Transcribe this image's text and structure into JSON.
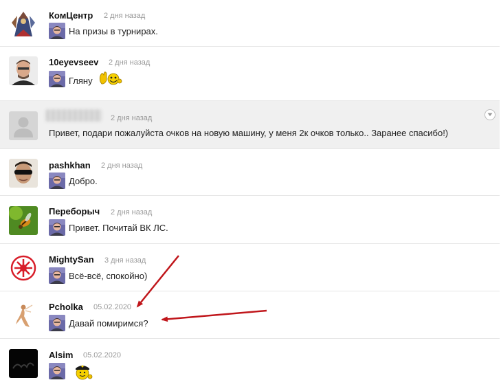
{
  "messages": [
    {
      "name": "КомЦентр",
      "time": "2 дня назад",
      "text": "На призы в турнирах."
    },
    {
      "name": "10eyevseev",
      "time": "2 дня назад",
      "text": "Гляну",
      "emoji": "waving-hand-smiley-icon"
    },
    {
      "name": "",
      "time": "2 дня назад",
      "text": "Привет, подари пожалуйста очков на новую машину, у меня 2к очков только.. Заранее спасибо!)"
    },
    {
      "name": "pashkhan",
      "time": "2 дня назад",
      "text": "Добро."
    },
    {
      "name": "Переборыч",
      "time": "2 дня назад",
      "text": "Привет. Почитай ВК ЛС."
    },
    {
      "name": "MightySan",
      "time": "3 дня назад",
      "text": "Всё-всё, спокойно)"
    },
    {
      "name": "Pcholka",
      "time": "05.02.2020",
      "text": "Давай помиримся?"
    },
    {
      "name": "Alsim",
      "time": "05.02.2020",
      "text": "",
      "emoji": "police-smiley-icon"
    }
  ],
  "colors": {
    "arrow": "#c0161b",
    "highlight": "#f0f0f0",
    "divider": "#e6e6e6"
  }
}
